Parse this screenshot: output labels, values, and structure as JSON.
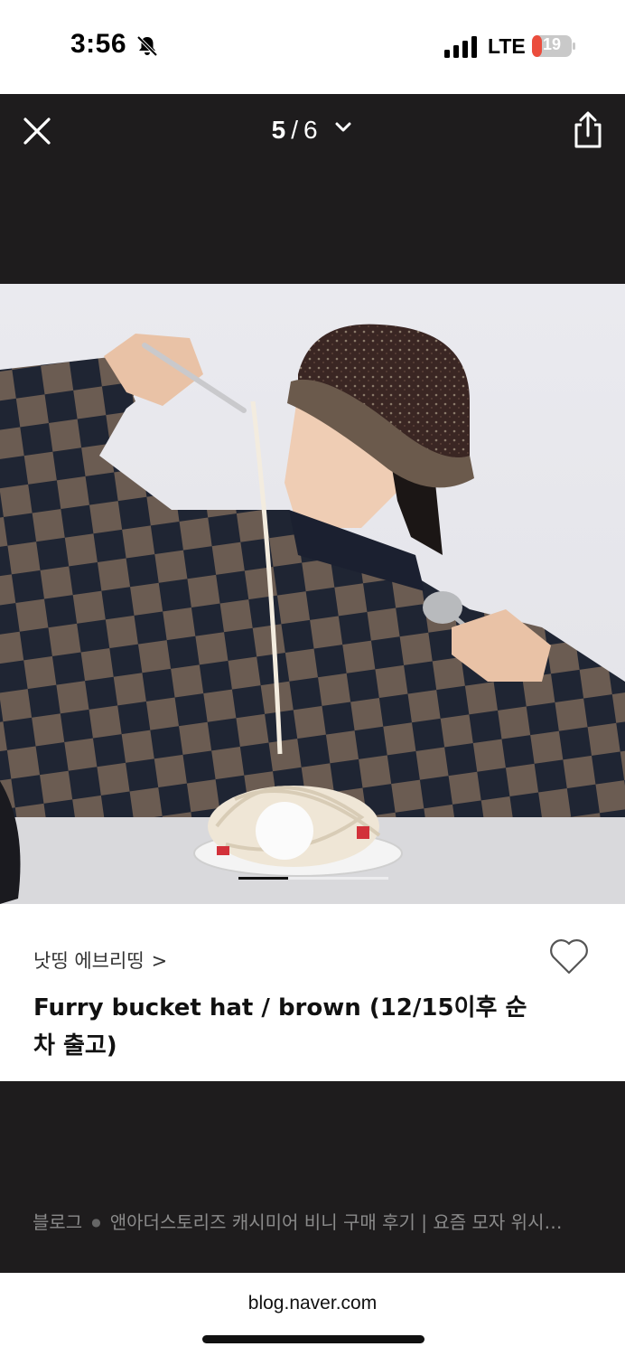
{
  "status": {
    "time": "3:56",
    "network": "LTE",
    "battery": "19",
    "battery_color": "#eb4d3d"
  },
  "viewer": {
    "current_page": "5",
    "page_separator": "/",
    "total_pages": "6"
  },
  "photo": {
    "progress_fraction": 0.33
  },
  "product": {
    "brand": "낫띵 에브리띵",
    "brand_arrow": ">",
    "title": "Furry bucket hat / brown (12/15이후 순차 출고)"
  },
  "source": {
    "type": "블로그",
    "post_title": "앤아더스토리즈 캐시미어 비니 구매 후기 | 요즘 모자 위시…"
  },
  "browser": {
    "url": "blog.naver.com"
  },
  "colors": {
    "viewer_background": "#1e1c1d",
    "text_light": "#ffffff",
    "text_muted": "#8a8a8a"
  },
  "icons": {
    "close": "close-icon",
    "dropdown": "chevron-down-icon",
    "share": "share-icon",
    "heart": "heart-outline-icon",
    "bell": "bell-slash-icon"
  }
}
